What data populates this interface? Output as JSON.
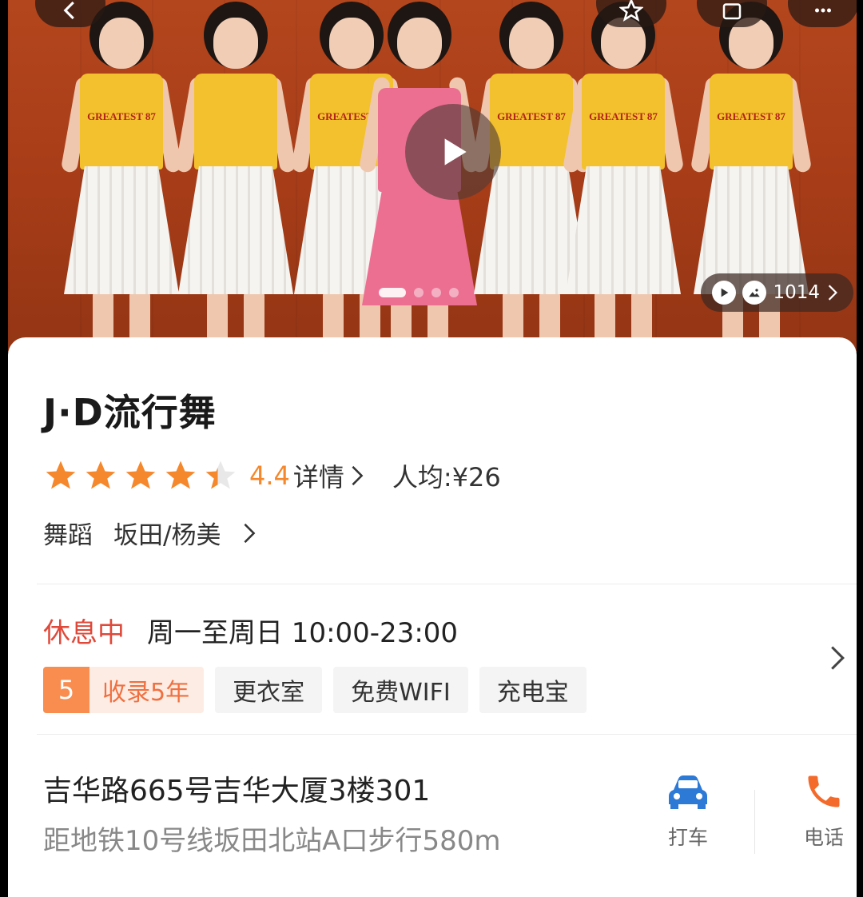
{
  "hero": {
    "media_count": "1014",
    "active_slide_index": 0,
    "slide_count": 4,
    "dancers": [
      {
        "shirt_text": "GREATEST 87"
      },
      {
        "shirt_text": ""
      },
      {
        "shirt_text": "GREATEST 87"
      },
      {
        "shirt_text": ""
      },
      {
        "shirt_text": "GREATEST 87"
      },
      {
        "shirt_text": "GREATEST 87"
      },
      {
        "shirt_text": "GREATEST 87"
      }
    ]
  },
  "shop": {
    "name": "J·D流行舞",
    "rating": 4.4,
    "rating_text": "4.4",
    "details_label": "详情",
    "avg_price": "人均:¥26",
    "category": "舞蹈",
    "area": "坂田/杨美"
  },
  "hours": {
    "status": "休息中",
    "schedule": "周一至周日 10:00-23:00"
  },
  "tags": {
    "years_num": "5",
    "years_label": "收录5年",
    "items": [
      "更衣室",
      "免费WIFI",
      "充电宝"
    ]
  },
  "location": {
    "address": "吉华路665号吉华大厦3楼301",
    "metro": "距地铁10号线坂田北站A口步行580m",
    "taxi_label": "打车",
    "phone_label": "电话"
  },
  "colors": {
    "accent_orange": "#f5872c",
    "status_red": "#e0493a",
    "tag_badge": "#f98d50",
    "taxi_blue": "#2d7ad6",
    "phone_orange": "#f36a2b"
  },
  "icons": [
    "back-icon",
    "star-outline-icon",
    "share-icon",
    "more-icon",
    "play-icon",
    "photo-icon",
    "chevron-right-icon",
    "car-icon",
    "phone-icon"
  ]
}
